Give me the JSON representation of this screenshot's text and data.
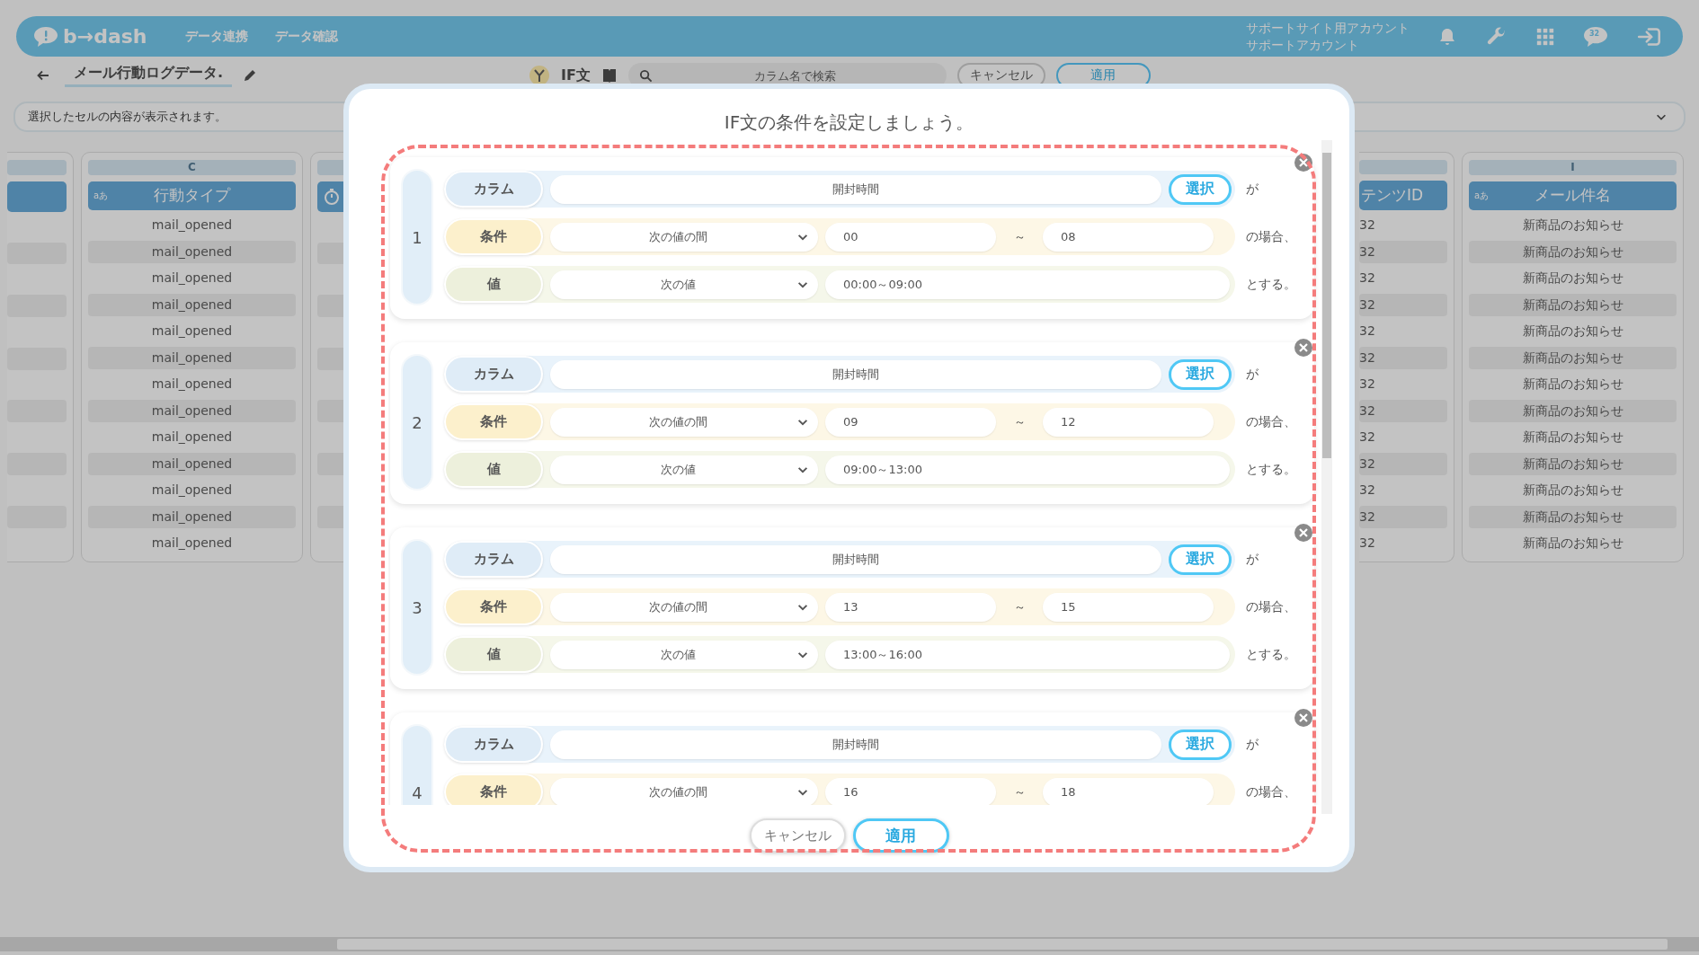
{
  "header": {
    "logo": "b→dash",
    "nav": [
      {
        "label": "データ連携"
      },
      {
        "label": "データ確認"
      }
    ],
    "account_lines": [
      "サポートサイト用アカウント",
      "サポートアカウント"
    ],
    "chat_badge": "32"
  },
  "toolbar": {
    "title": "メール行動ログデータ.",
    "mode": "IF文",
    "search_placeholder": "カラム名で検索",
    "cancel": "キャンセル",
    "apply": "適用"
  },
  "cell_bar": {
    "placeholder": "選択したセルの内容が表示されます。"
  },
  "table": {
    "columns": [
      {
        "kind": "blank"
      },
      {
        "kind": "text",
        "letter": "C",
        "type_label": "aあ",
        "title": "行動タイプ",
        "cells": [
          "mail_opened",
          "mail_opened",
          "mail_opened",
          "mail_opened",
          "mail_opened",
          "mail_opened",
          "mail_opened",
          "mail_opened",
          "mail_opened",
          "mail_opened",
          "mail_opened",
          "mail_opened",
          "mail_opened"
        ]
      },
      {
        "kind": "time"
      },
      {
        "kind": "cut",
        "title": "テンツID",
        "cells": [
          "32",
          "32",
          "32",
          "32",
          "32",
          "32",
          "32",
          "32",
          "32",
          "32",
          "32",
          "32",
          "32"
        ]
      },
      {
        "kind": "text",
        "letter": "I",
        "type_label": "aあ",
        "title": "メール件名",
        "cells": [
          "新商品のお知らせ",
          "新商品のお知らせ",
          "新商品のお知らせ",
          "新商品のお知らせ",
          "新商品のお知らせ",
          "新商品のお知らせ",
          "新商品のお知らせ",
          "新商品のお知らせ",
          "新商品のお知らせ",
          "新商品のお知らせ",
          "新商品のお知らせ",
          "新商品のお知らせ",
          "新商品のお知らせ"
        ]
      }
    ]
  },
  "modal": {
    "title": "IF文の条件を設定しましょう。",
    "rules": [
      {
        "number": "1",
        "column_label": "カラム",
        "column": "開封時間",
        "select_button": "選択",
        "column_suffix": "が",
        "condition_label": "条件",
        "operator": "次の値の間",
        "from": "00",
        "range_sep": "～",
        "to": "08",
        "condition_suffix": "の場合、",
        "value_label": "値",
        "value_mode": "次の値",
        "value": "00:00～09:00",
        "value_suffix": "とする。"
      },
      {
        "number": "2",
        "column_label": "カラム",
        "column": "開封時間",
        "select_button": "選択",
        "column_suffix": "が",
        "condition_label": "条件",
        "operator": "次の値の間",
        "from": "09",
        "range_sep": "～",
        "to": "12",
        "condition_suffix": "の場合、",
        "value_label": "値",
        "value_mode": "次の値",
        "value": "09:00～13:00",
        "value_suffix": "とする。"
      },
      {
        "number": "3",
        "column_label": "カラム",
        "column": "開封時間",
        "select_button": "選択",
        "column_suffix": "が",
        "condition_label": "条件",
        "operator": "次の値の間",
        "from": "13",
        "range_sep": "～",
        "to": "15",
        "condition_suffix": "の場合、",
        "value_label": "値",
        "value_mode": "次の値",
        "value": "13:00～16:00",
        "value_suffix": "とする。"
      },
      {
        "number": "4",
        "column_label": "カラム",
        "column": "開封時間",
        "select_button": "選択",
        "column_suffix": "が",
        "condition_label": "条件",
        "operator": "次の値の間",
        "from": "16",
        "range_sep": "～",
        "to": "18",
        "condition_suffix": "の場合、"
      }
    ],
    "cancel": "キャンセル",
    "apply": "適用"
  }
}
